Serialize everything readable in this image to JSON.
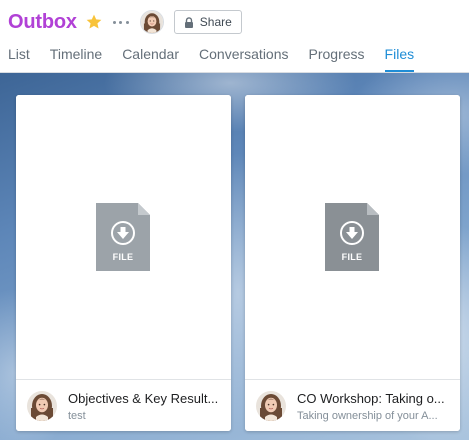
{
  "project": {
    "title": "Outbox",
    "favorite_icon": "star-icon",
    "favorite_color": "#f8c33a",
    "title_color": "#b141d6",
    "more_icon": "more-icon",
    "share_label": "Share",
    "share_icon": "lock-icon"
  },
  "tabs": [
    {
      "label": "List",
      "active": false
    },
    {
      "label": "Timeline",
      "active": false
    },
    {
      "label": "Calendar",
      "active": false
    },
    {
      "label": "Conversations",
      "active": false
    },
    {
      "label": "Progress",
      "active": false
    },
    {
      "label": "Files",
      "active": true
    }
  ],
  "accent_color": "#1f8dd6",
  "files": [
    {
      "type_label": "FILE",
      "icon": "file-download-icon",
      "title": "Objectives & Key Result...",
      "subtitle": "test"
    },
    {
      "type_label": "FILE",
      "icon": "file-download-icon",
      "title": "CO Workshop: Taking o...",
      "subtitle": "Taking ownership of your A..."
    }
  ]
}
